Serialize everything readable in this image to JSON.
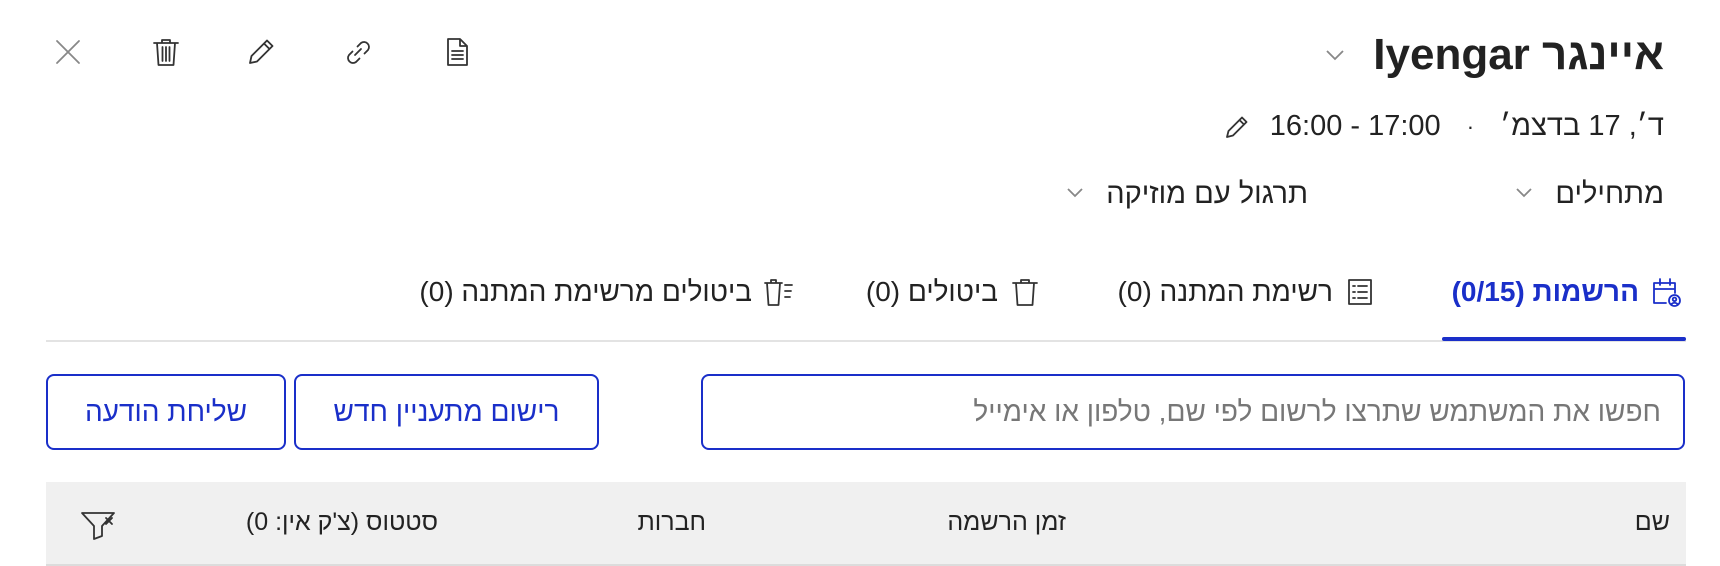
{
  "header": {
    "title": "איינגר Iyengar",
    "date": "ד׳, 17 בדצמ׳",
    "separator": "·",
    "time": "16:00 - 17:00"
  },
  "toolbar": {
    "icons": [
      "close-icon",
      "trash-icon",
      "pencil-icon",
      "link-icon",
      "document-icon"
    ]
  },
  "filters": {
    "level": "מתחילים",
    "practice": "תרגול עם מוזיקה"
  },
  "tabs": [
    {
      "label": "הרשמות (0/15)",
      "active": true
    },
    {
      "label": "רשימת המתנה (0)",
      "active": false
    },
    {
      "label": "ביטולים (0)",
      "active": false
    },
    {
      "label": "ביטולים מרשימת המתנה (0)",
      "active": false
    }
  ],
  "search": {
    "placeholder": "חפשו את המשתמש שתרצו לרשום לפי שם, טלפון או אימייל",
    "value": ""
  },
  "buttons": {
    "register_lead": "רישום מתעניין חדש",
    "send_message": "שליחת הודעה"
  },
  "table": {
    "columns": [
      "שם",
      "זמן הרשמה",
      "חברות",
      "סטטוס (צ'ק אין: 0)"
    ]
  },
  "colors": {
    "accent": "#1a2fc9",
    "header_bg": "#f0f0f0"
  }
}
